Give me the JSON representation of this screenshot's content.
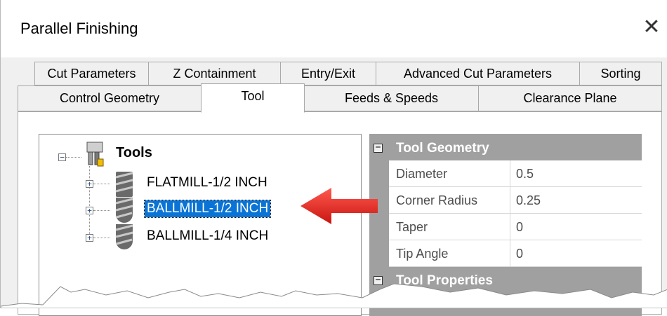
{
  "dialog": {
    "title": "Parallel Finishing",
    "close_glyph": "✕"
  },
  "tabs": {
    "row1": [
      {
        "label": "Cut Parameters"
      },
      {
        "label": "Z Containment"
      },
      {
        "label": "Entry/Exit"
      },
      {
        "label": "Advanced Cut Parameters"
      },
      {
        "label": "Sorting"
      }
    ],
    "row2": [
      {
        "label": "Control Geometry"
      },
      {
        "label": "Tool",
        "active": true
      },
      {
        "label": "Feeds & Speeds"
      },
      {
        "label": "Clearance Plane"
      }
    ]
  },
  "tree": {
    "root": {
      "label": "Tools",
      "expander": "−",
      "icon": "tools-folder-icon"
    },
    "items": [
      {
        "label": "FLATMILL-1/2 INCH",
        "expander": "+",
        "icon": "flatmill-icon",
        "selected": false
      },
      {
        "label": "BALLMILL-1/2 INCH",
        "expander": "+",
        "icon": "ballmill-icon",
        "selected": true
      },
      {
        "label": "BALLMILL-1/4 INCH",
        "expander": "+",
        "icon": "ballmill-icon",
        "selected": false
      }
    ]
  },
  "properties": {
    "categories": [
      {
        "name": "Tool Geometry",
        "toggle": "−",
        "rows": [
          {
            "key": "Diameter",
            "value": "0.5"
          },
          {
            "key": "Corner Radius",
            "value": "0.25"
          },
          {
            "key": "Taper",
            "value": "0"
          },
          {
            "key": "Tip Angle",
            "value": "0"
          }
        ]
      },
      {
        "name": "Tool Properties",
        "toggle": "−",
        "rows": []
      }
    ]
  },
  "annotation": {
    "icon": "red-arrow-icon",
    "color": "#e0211c"
  },
  "colors": {
    "selection": "#0a74d6",
    "property_header": "#a0a0a0"
  }
}
